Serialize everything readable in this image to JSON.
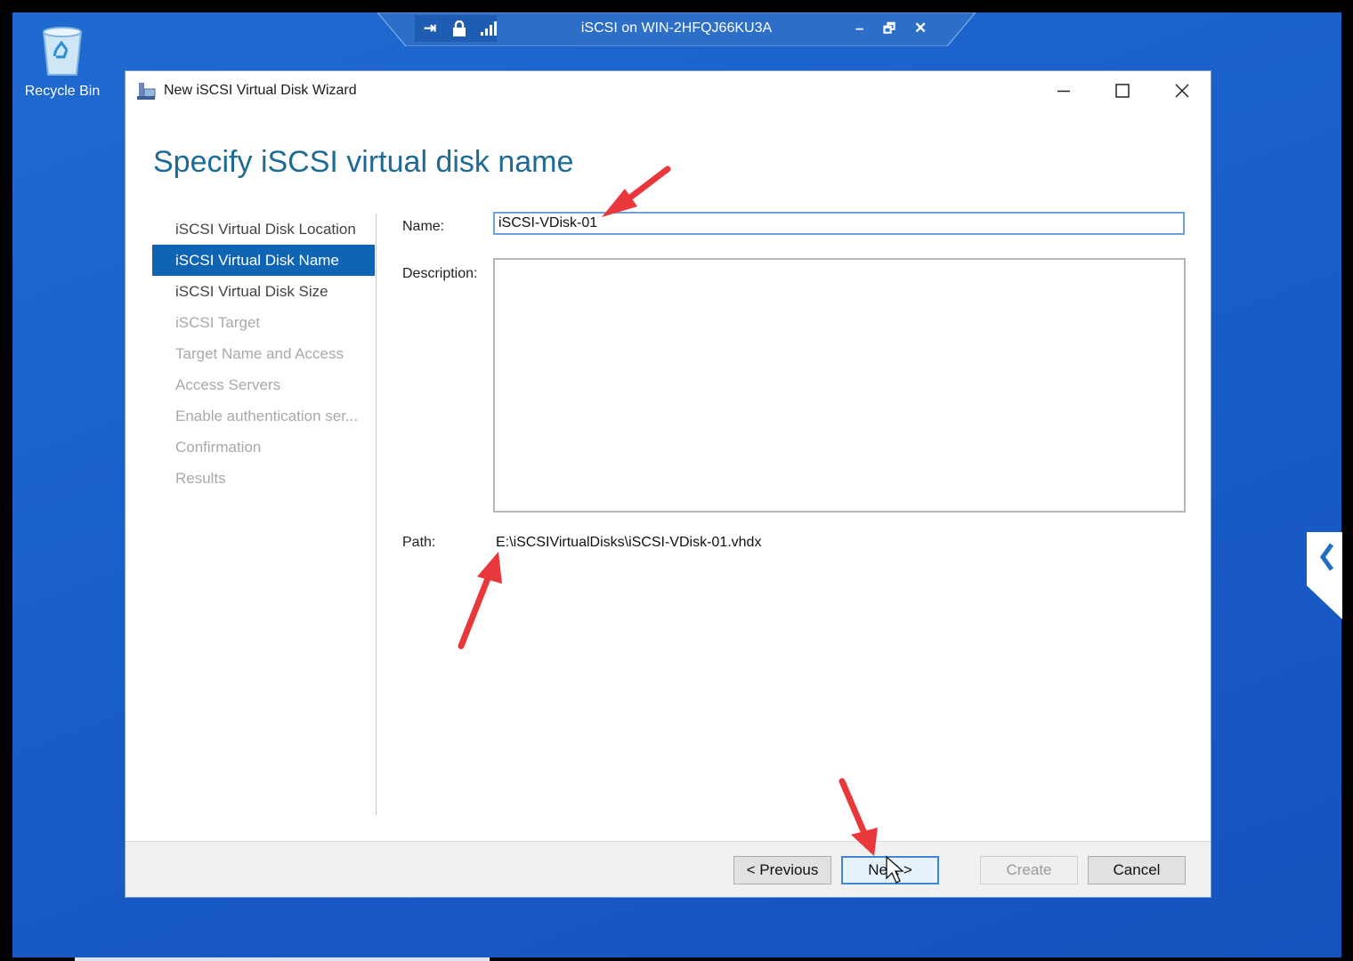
{
  "desktop": {
    "recycle_bin_label": "Recycle Bin"
  },
  "rdp_bar": {
    "title": "iSCSI on WIN-2HFQJ66KU3A",
    "pin_icon": "pin-icon",
    "lock_icon": "lock-icon",
    "signal_icon": "signal-icon",
    "minimize_glyph": "–",
    "restore_glyph": "🗗",
    "close_glyph": "✕"
  },
  "window": {
    "title": "New iSCSI Virtual Disk Wizard",
    "heading": "Specify iSCSI virtual disk name"
  },
  "steps": [
    {
      "label": "iSCSI Virtual Disk Location",
      "state": "done"
    },
    {
      "label": "iSCSI Virtual Disk Name",
      "state": "active"
    },
    {
      "label": "iSCSI Virtual Disk Size",
      "state": "done"
    },
    {
      "label": "iSCSI Target",
      "state": "pending"
    },
    {
      "label": "Target Name and Access",
      "state": "pending"
    },
    {
      "label": "Access Servers",
      "state": "pending"
    },
    {
      "label": "Enable authentication ser...",
      "state": "pending"
    },
    {
      "label": "Confirmation",
      "state": "pending"
    },
    {
      "label": "Results",
      "state": "pending"
    }
  ],
  "form": {
    "name_label": "Name:",
    "name_value": "iSCSI-VDisk-01",
    "description_label": "Description:",
    "description_value": "",
    "path_label": "Path:",
    "path_value": "E:\\iSCSIVirtualDisks\\iSCSI-VDisk-01.vhdx"
  },
  "buttons": {
    "previous": "< Previous",
    "next": "Next >",
    "create": "Create",
    "cancel": "Cancel"
  },
  "colors": {
    "accent": "#0f64b4",
    "heading": "#1e6a96",
    "annotation_arrow": "#e8383b",
    "desktop": "#1a5fcb"
  }
}
